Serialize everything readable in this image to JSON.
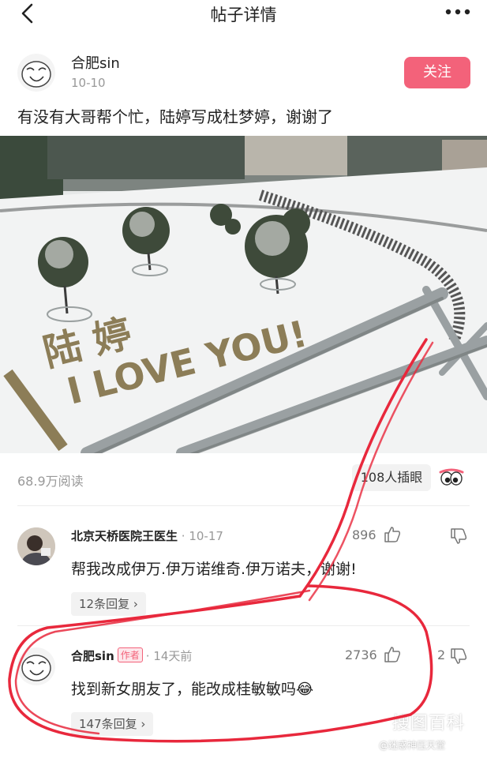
{
  "nav": {
    "title": "帖子详情"
  },
  "post": {
    "author": "合肥sin",
    "date": "10-10",
    "follow_label": "关注",
    "text": "有没有大哥帮个忙，陆婷写成杜梦婷，谢谢了",
    "photo": {
      "snow_text_line1": "陆 婷",
      "snow_text_line2": "I LOVE YOU!"
    },
    "reads": "68.9万阅读",
    "eye_label": "108人插眼"
  },
  "comments": [
    {
      "name": "北京天桥医院王医生",
      "time": "10-17",
      "likes": "896",
      "text": "帮我改成伊万.伊万诺维奇.伊万诺夫，谢谢!",
      "replies": "12条回复"
    },
    {
      "name": "合肥sin",
      "badge": "作者",
      "time": "14天前",
      "likes": "2736",
      "dislikes": "2",
      "text": "找到新女朋友了，能改成桂敏敏吗😂",
      "replies": "147条回复"
    }
  ],
  "watermark": {
    "main": "搜图百科",
    "sub": "@迷惑神压天堂"
  },
  "colors": {
    "accent": "#f3627a",
    "annotation": "#e8283c"
  }
}
